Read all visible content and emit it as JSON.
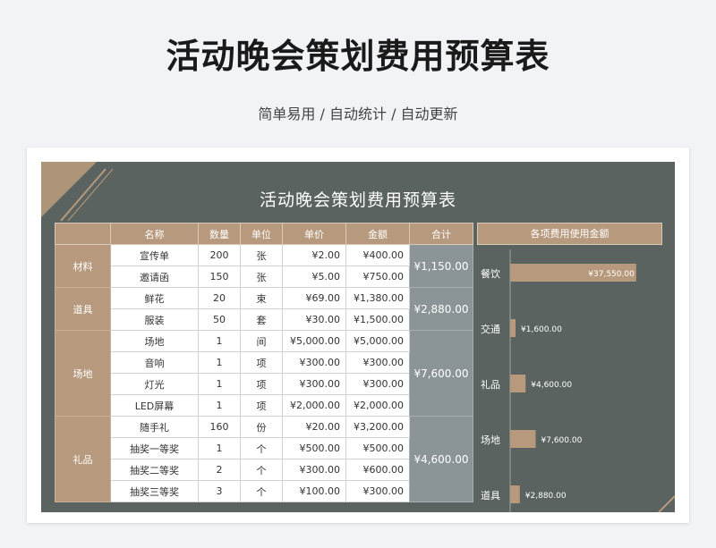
{
  "header": {
    "title": "活动晚会策划费用预算表",
    "subtitle": "简单易用 / 自动统计 / 自动更新"
  },
  "sheet": {
    "title": "活动晚会策划费用预算表",
    "columns": [
      "名称",
      "数量",
      "单位",
      "单价",
      "金额",
      "合计"
    ],
    "groups": [
      {
        "category": "材料",
        "total": "¥1,150.00",
        "items": [
          {
            "name": "宣传单",
            "qty": "200",
            "unit": "张",
            "price": "¥2.00",
            "amount": "¥400.00"
          },
          {
            "name": "邀请函",
            "qty": "150",
            "unit": "张",
            "price": "¥5.00",
            "amount": "¥750.00"
          }
        ]
      },
      {
        "category": "道具",
        "total": "¥2,880.00",
        "items": [
          {
            "name": "鲜花",
            "qty": "20",
            "unit": "束",
            "price": "¥69.00",
            "amount": "¥1,380.00"
          },
          {
            "name": "服装",
            "qty": "50",
            "unit": "套",
            "price": "¥30.00",
            "amount": "¥1,500.00"
          }
        ]
      },
      {
        "category": "场地",
        "total": "¥7,600.00",
        "items": [
          {
            "name": "场地",
            "qty": "1",
            "unit": "间",
            "price": "¥5,000.00",
            "amount": "¥5,000.00"
          },
          {
            "name": "音响",
            "qty": "1",
            "unit": "项",
            "price": "¥300.00",
            "amount": "¥300.00"
          },
          {
            "name": "灯光",
            "qty": "1",
            "unit": "项",
            "price": "¥300.00",
            "amount": "¥300.00"
          },
          {
            "name": "LED屏幕",
            "qty": "1",
            "unit": "项",
            "price": "¥2,000.00",
            "amount": "¥2,000.00"
          }
        ]
      },
      {
        "category": "礼品",
        "total": "¥4,600.00",
        "items": [
          {
            "name": "随手礼",
            "qty": "160",
            "unit": "份",
            "price": "¥20.00",
            "amount": "¥3,200.00"
          },
          {
            "name": "抽奖一等奖",
            "qty": "1",
            "unit": "个",
            "price": "¥500.00",
            "amount": "¥500.00"
          },
          {
            "name": "抽奖二等奖",
            "qty": "2",
            "unit": "个",
            "price": "¥300.00",
            "amount": "¥600.00"
          },
          {
            "name": "抽奖三等奖",
            "qty": "3",
            "unit": "个",
            "price": "¥100.00",
            "amount": "¥300.00"
          }
        ]
      }
    ]
  },
  "chart_data": {
    "type": "bar",
    "orientation": "horizontal",
    "title": "各项费用使用金额",
    "categories": [
      "餐饮",
      "交通",
      "礼品",
      "场地",
      "道具"
    ],
    "values": [
      37550,
      1600,
      4600,
      7600,
      2880
    ],
    "value_labels": [
      "¥37,550.00",
      "¥1,600.00",
      "¥4,600.00",
      "¥7,600.00",
      "¥2,880.00"
    ],
    "xlim": [
      0,
      40000
    ],
    "bar_color": "#b79a7d",
    "grid": false,
    "legend": "none"
  },
  "colors": {
    "sheet_bg": "#5a6360",
    "accent": "#b79a7d",
    "total_cell": "#8b9597"
  }
}
